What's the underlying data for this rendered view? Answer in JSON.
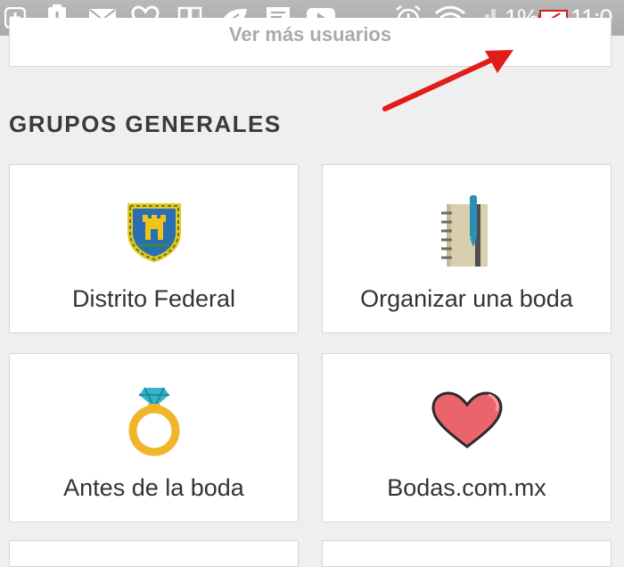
{
  "status_bar": {
    "battery_percent": "1%",
    "time": "11:0",
    "icons": [
      "add-icon",
      "alert-icon",
      "mail-icon",
      "heart-icon",
      "book-icon",
      "leaf-icon",
      "chat-icon",
      "play-icon",
      "alarm-icon",
      "wifi-icon",
      "signal-icon",
      "battery-low-icon"
    ]
  },
  "more_users_button": {
    "label": "Ver más usuarios"
  },
  "section": {
    "title": "GRUPOS GENERALES"
  },
  "groups": [
    {
      "label": "Distrito Federal",
      "icon": "coat-of-arms-icon"
    },
    {
      "label": "Organizar una boda",
      "icon": "notebook-icon"
    },
    {
      "label": "Antes de la boda",
      "icon": "ring-icon"
    },
    {
      "label": "Bodas.com.mx",
      "icon": "heart-icon"
    }
  ],
  "colors": {
    "annotation_arrow": "#e21b1b",
    "battery_warning": "#d11e1e"
  }
}
